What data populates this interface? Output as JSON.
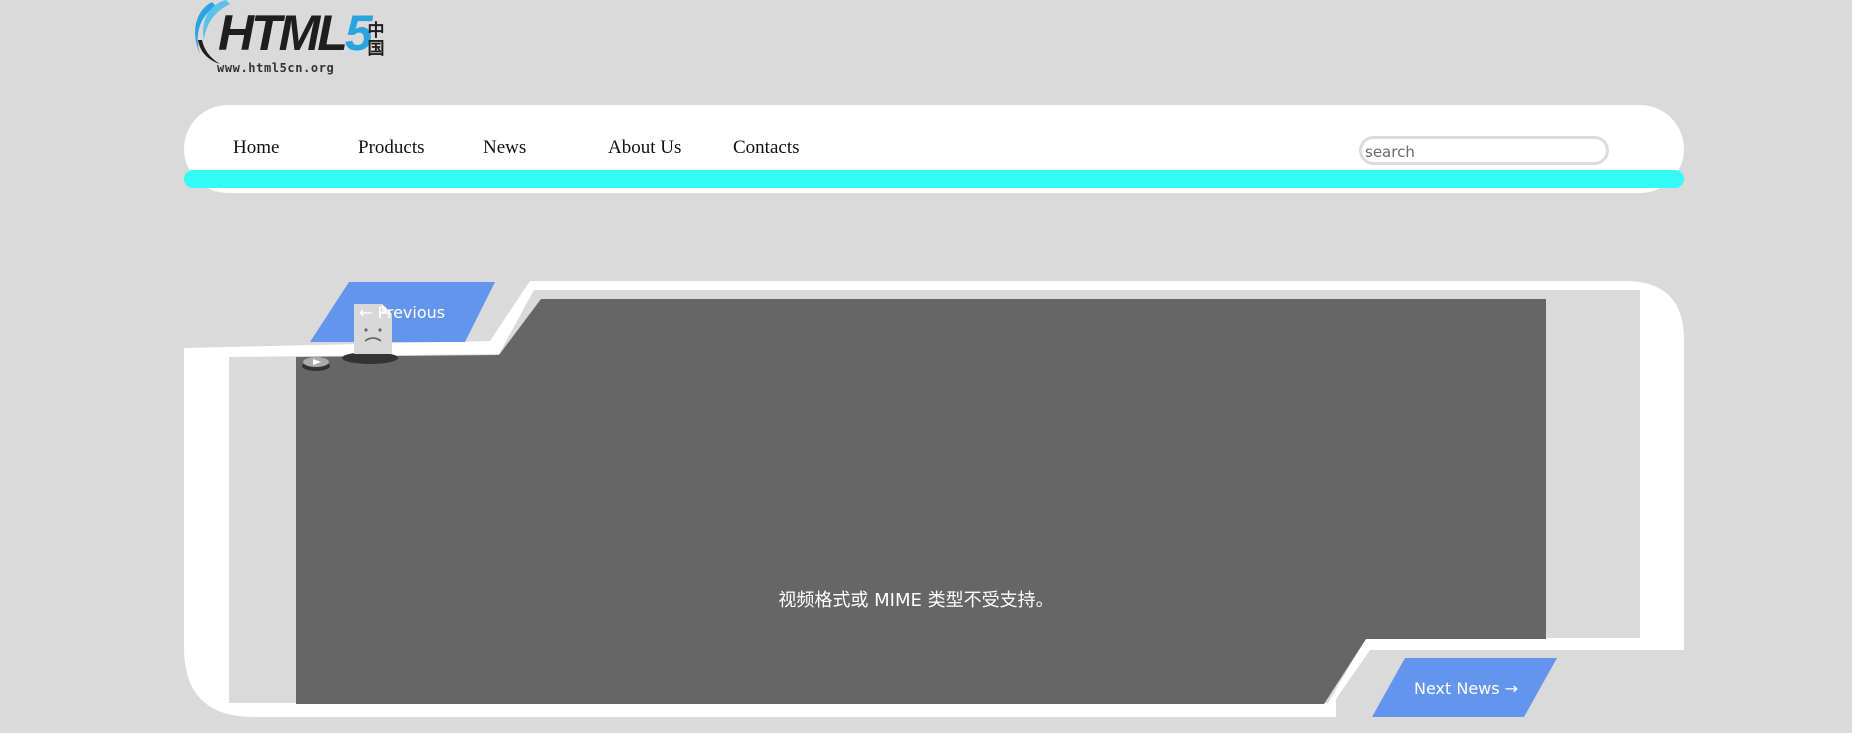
{
  "logo": {
    "name": "HTML",
    "five": "5",
    "cn": "中国",
    "url": "www.html5cn.org"
  },
  "nav": {
    "items": [
      "Home",
      "Products",
      "News",
      "About Us",
      "Contacts"
    ],
    "search_placeholder": "search"
  },
  "content": {
    "prev_label": "← Previous",
    "next_label": "Next News →",
    "video_error": "视频格式或 MIME 类型不受支持。"
  },
  "colors": {
    "background": "#dadada",
    "nav_accent": "#33fbf6",
    "button_blue": "#6495ed",
    "video_bg": "#666666"
  }
}
